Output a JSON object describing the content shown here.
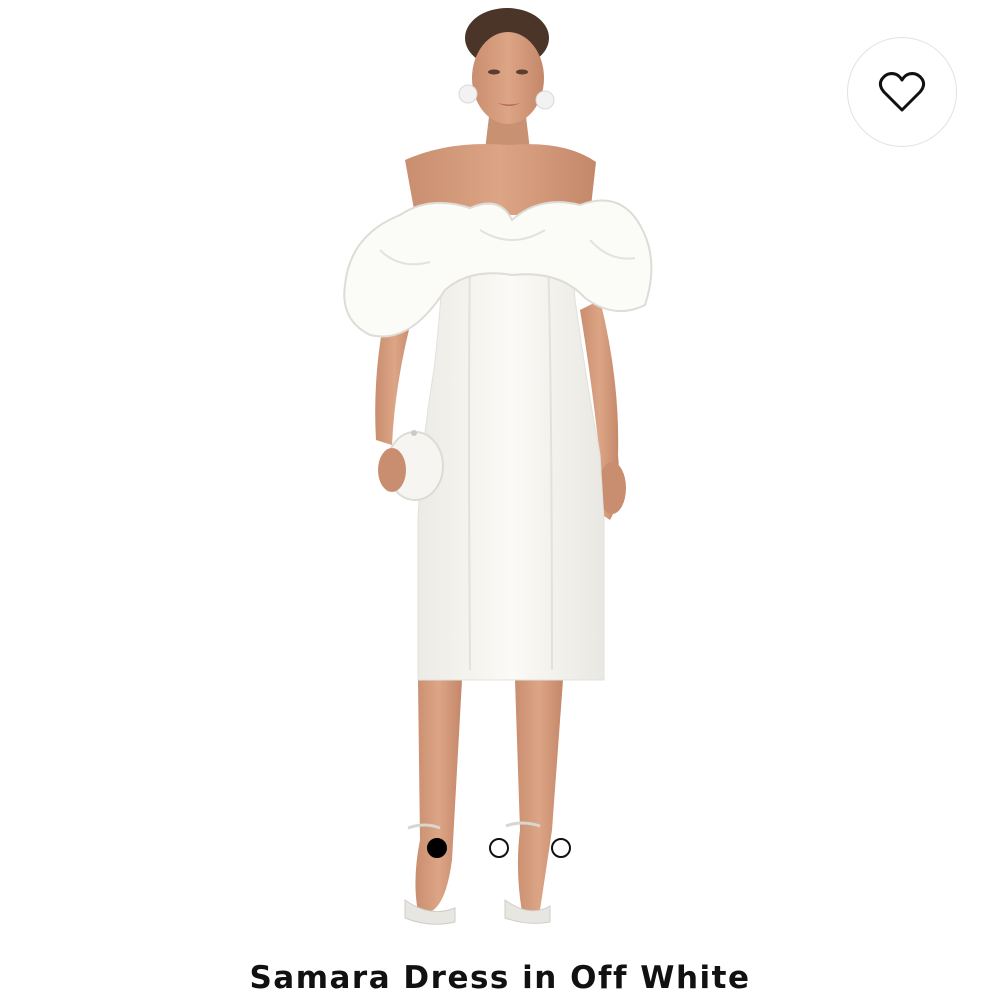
{
  "product": {
    "title": "Samara Dress in Off White",
    "image_alt": "Model wearing Samara Dress in Off White"
  },
  "wishlist": {
    "icon": "heart-outline-icon",
    "label": "Add to wishlist"
  },
  "carousel": {
    "total": 3,
    "active_index": 0
  },
  "colors": {
    "background": "#ffffff",
    "text": "#111111",
    "dress": "#f8f6f1"
  }
}
